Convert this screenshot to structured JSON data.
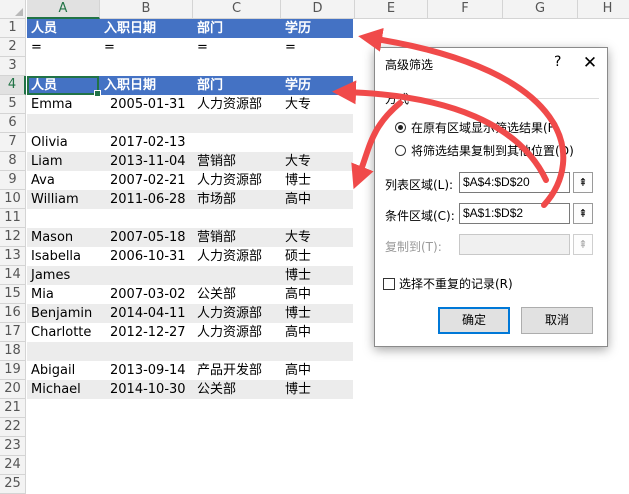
{
  "columns": [
    "A",
    "B",
    "C",
    "D",
    "E",
    "F",
    "G",
    "H"
  ],
  "rows": [
    "1",
    "2",
    "3",
    "4",
    "5",
    "6",
    "7",
    "8",
    "9",
    "10",
    "11",
    "12",
    "13",
    "14",
    "15",
    "16",
    "17",
    "18",
    "19",
    "20",
    "21",
    "22",
    "23",
    "24",
    "25"
  ],
  "criteria": {
    "headers": [
      "人员",
      "入职日期",
      "部门",
      "学历"
    ],
    "values": [
      "=",
      "=",
      "=",
      "="
    ]
  },
  "table": {
    "headers": [
      "人员",
      "入职日期",
      "部门",
      "学历"
    ],
    "rows": [
      [
        "Emma",
        "2005-01-31",
        "人力资源部",
        "大专"
      ],
      [
        "",
        "",
        "",
        ""
      ],
      [
        "Olivia",
        "2017-02-13",
        "",
        ""
      ],
      [
        "Liam",
        "2013-11-04",
        "营销部",
        "大专"
      ],
      [
        "Ava",
        "2007-02-21",
        "人力资源部",
        "博士"
      ],
      [
        "William",
        "2011-06-28",
        "市场部",
        "高中"
      ],
      [
        "",
        "",
        "",
        ""
      ],
      [
        "Mason",
        "2007-05-18",
        "营销部",
        "大专"
      ],
      [
        "Isabella",
        "2006-10-31",
        "人力资源部",
        "硕士"
      ],
      [
        "James",
        "",
        "",
        "博士"
      ],
      [
        "Mia",
        "2007-03-02",
        "公关部",
        "高中"
      ],
      [
        "Benjamin",
        "2014-04-11",
        "人力资源部",
        "博士"
      ],
      [
        "Charlotte",
        "2012-12-27",
        "人力资源部",
        "高中"
      ],
      [
        "",
        "",
        "",
        ""
      ],
      [
        "Abigail",
        "2013-09-14",
        "产品开发部",
        "高中"
      ],
      [
        "Michael",
        "2014-10-30",
        "公关部",
        "博士"
      ]
    ]
  },
  "dialog": {
    "title": "高级筛选",
    "help": "?",
    "close": "✕",
    "group_label": "方式",
    "option_in_place": "在原有区域显示筛选结果(F)",
    "option_copy": "将筛选结果复制到其他位置(O)",
    "list_range_label": "列表区域(L):",
    "list_range_value": "$A$4:$D$20",
    "criteria_range_label": "条件区域(C):",
    "criteria_range_value": "$A$1:$D$2",
    "copy_to_label": "复制到(T):",
    "copy_to_value": "",
    "unique_label": "选择不重复的记录(R)",
    "ok": "确定",
    "cancel": "取消",
    "collapse_icon": "⇞"
  },
  "colors": {
    "header_band": "#4472c4",
    "stripe": "#ececec",
    "arrow": "#f04a4a",
    "selection": "#217346"
  }
}
